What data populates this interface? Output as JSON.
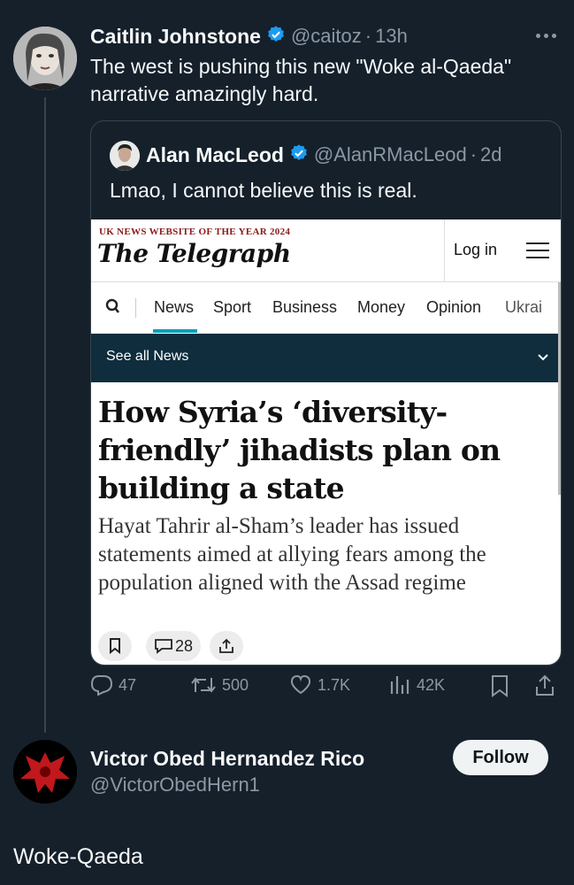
{
  "main_tweet": {
    "name": "Caitlin Johnstone",
    "handle": "@caitoz",
    "time": "13h",
    "text": "The west is pushing this new \"Woke al-Qaeda\" narrative amazingly hard."
  },
  "quoted_tweet": {
    "name": "Alan MacLeod",
    "handle": "@AlanRMacLeod",
    "time": "2d",
    "text": "Lmao, I cannot believe this is real."
  },
  "article": {
    "tagline": "UK NEWS WEBSITE OF THE YEAR 2024",
    "logo": "The Telegraph",
    "login": "Log in",
    "nav": [
      "News",
      "Sport",
      "Business",
      "Money",
      "Opinion",
      "Ukrai"
    ],
    "section_bar": "See all News",
    "headline": "How Syria’s ‘diversity-friendly’ jihadists plan on building a state",
    "subheading": "Hayat Tahrir al-Sham’s leader has issued statements aimed at allying fears among the population aligned with the Assad regime",
    "comment_count": "28"
  },
  "stats": {
    "replies": "47",
    "retweets": "500",
    "likes": "1.7K",
    "views": "42K"
  },
  "reply": {
    "name": "Victor Obed Hernandez Rico",
    "handle": "@VictorObedHern1",
    "follow_label": "Follow",
    "text": "Woke-Qaeda"
  },
  "colors": {
    "background": "#15202b",
    "verified": "#1d9bf0",
    "muted": "#8b98a5",
    "telegraph_bar": "#0f2d3d",
    "telegraph_accent": "#00a2b3"
  }
}
